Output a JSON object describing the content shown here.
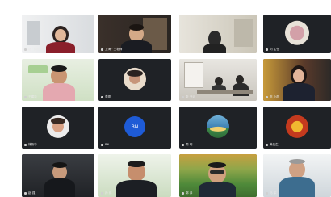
{
  "tiles": [
    {
      "name": "赵 · 网络会议"
    },
    {
      "name": "上海 · 王老师"
    },
    {
      "name": ""
    },
    {
      "name": "刘 主任"
    },
    {
      "name": "王建华"
    },
    {
      "name": "李秀"
    },
    {
      "name": "张 书记"
    },
    {
      "name": "陈 小丽"
    },
    {
      "name": "林新华"
    },
    {
      "name": "BN"
    },
    {
      "name": "周 明"
    },
    {
      "name": "黄先生"
    },
    {
      "name": "赵 强"
    },
    {
      "name": "孙 伟"
    },
    {
      "name": "郭 泽"
    },
    {
      "name": "马 军"
    }
  ],
  "avatar_text": {
    "bn": "BN"
  },
  "colors": {
    "tile_bg": "#1f2226",
    "label": "#e9e9e9",
    "bn_blue": "#1e5bd6"
  }
}
